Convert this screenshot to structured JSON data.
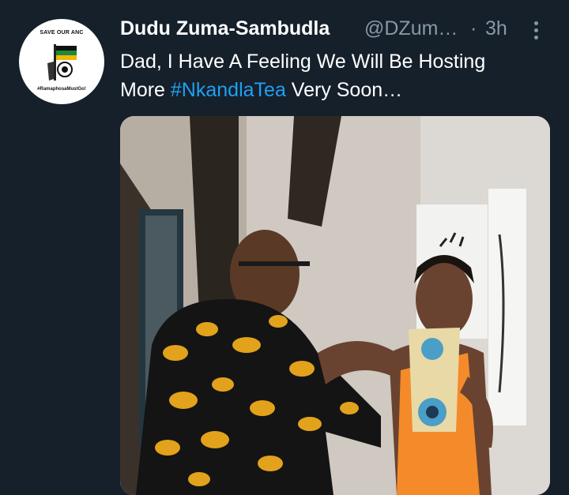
{
  "avatar": {
    "top_text": "SAVE OUR ANC",
    "logo_text": "ANC",
    "bottom_text": "#RamaphosaMustGo!"
  },
  "tweet": {
    "display_name": "Dudu Zuma-Sambudla",
    "handle": "@DZum…",
    "separator": "·",
    "time": "3h",
    "text_line1": "Dad, I Have A Feeling We Will Be Hosting",
    "text_line2_before": "More ",
    "hashtag": "#NkandlaTea",
    "text_line2_after": " Very Soon…"
  },
  "icons": {
    "more": "more-vertical-icon"
  },
  "colors": {
    "background": "#15202b",
    "secondary_text": "#8899a6",
    "hashtag": "#1da1f2"
  }
}
